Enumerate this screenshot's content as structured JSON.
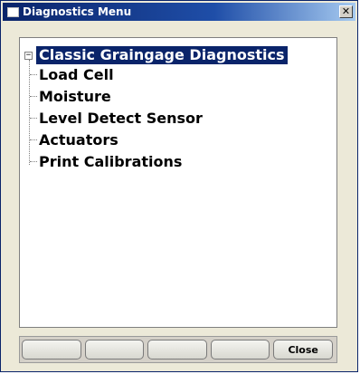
{
  "window": {
    "title": "Diagnostics Menu",
    "close_glyph": "✕"
  },
  "tree": {
    "root_label": "Classic Graingage Diagnostics",
    "expander_glyph": "−",
    "children": [
      {
        "label": "Load Cell"
      },
      {
        "label": "Moisture"
      },
      {
        "label": "Level Detect Sensor"
      },
      {
        "label": "Actuators"
      },
      {
        "label": "Print Calibrations"
      }
    ]
  },
  "buttons": [
    {
      "label": ""
    },
    {
      "label": ""
    },
    {
      "label": ""
    },
    {
      "label": ""
    },
    {
      "label": "Close"
    }
  ],
  "colors": {
    "titlebar": "#0a246a",
    "selection": "#0a246a",
    "window_bg": "#ece9d8"
  },
  "icons": {
    "title_icon": "window-icon",
    "close_icon": "close-icon",
    "expander_icon": "tree-collapse-icon"
  }
}
